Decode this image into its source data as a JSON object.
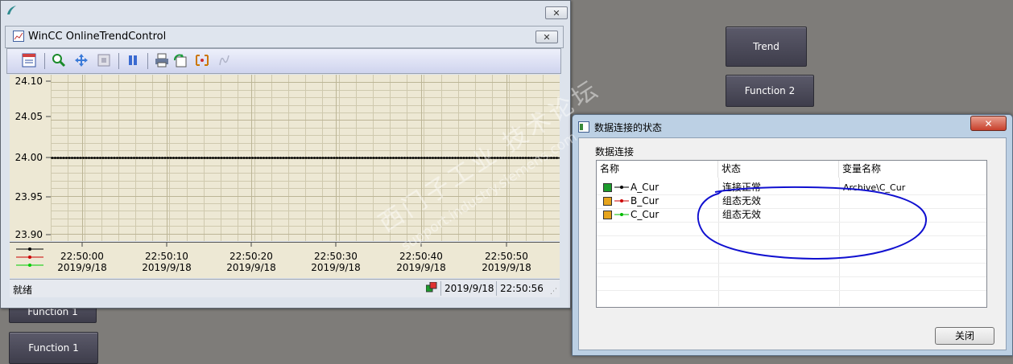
{
  "background_buttons": {
    "trend": "Trend",
    "function2": "Function 2",
    "function1a": "Function 1",
    "function1b": "Function 1"
  },
  "control": {
    "title": "WinCC OnlineTrendControl",
    "y_ticks": [
      "24.10",
      "24.05",
      "24.00",
      "23.95",
      "23.90"
    ],
    "x_ticks": [
      {
        "time": "22:50:00",
        "date": "2019/9/18"
      },
      {
        "time": "22:50:10",
        "date": "2019/9/18"
      },
      {
        "time": "22:50:20",
        "date": "2019/9/18"
      },
      {
        "time": "22:50:30",
        "date": "2019/9/18"
      },
      {
        "time": "22:50:40",
        "date": "2019/9/18"
      },
      {
        "time": "22:50:50",
        "date": "2019/9/18"
      }
    ],
    "status_text": "就绪",
    "status_date": "2019/9/18",
    "status_time": "22:50:56"
  },
  "chart_data": {
    "type": "line",
    "series": [
      {
        "values": [
          24.0,
          24.0,
          24.0,
          24.0,
          24.0,
          24.0,
          24.0
        ]
      }
    ],
    "x": [
      "22:50:00",
      "22:50:10",
      "22:50:20",
      "22:50:30",
      "22:50:40",
      "22:50:50",
      "22:50:56"
    ],
    "ylim": [
      23.89,
      24.11
    ],
    "grid": true
  },
  "dialog": {
    "title": "数据连接的状态",
    "group_label": "数据连接",
    "columns": [
      "名称",
      "状态",
      "变量名称"
    ],
    "rows": [
      {
        "name": "A_Cur",
        "status": "连接正常",
        "tag": "Archive\\C_Cur",
        "color": "#000000"
      },
      {
        "name": "B_Cur",
        "status": "组态无效",
        "tag": "",
        "color": "#cc0000"
      },
      {
        "name": "C_Cur",
        "status": "组态无效",
        "tag": "",
        "color": "#00bb00"
      }
    ],
    "close_label": "关闭"
  },
  "watermark": {
    "line1": "西门子工业 技术论坛",
    "line2": "support.industry.siemens.com"
  },
  "colors": {
    "annotation": "#1010d0",
    "plot_bg": "#ede8d4"
  }
}
